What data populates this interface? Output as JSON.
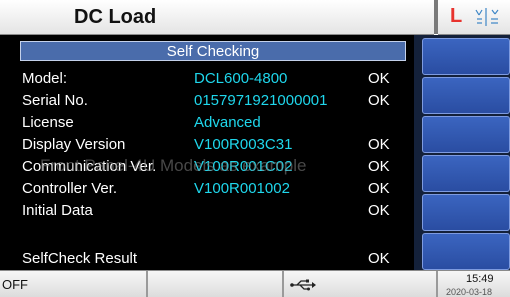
{
  "header": {
    "title": "DC Load",
    "brand_glyph": "L",
    "status_icon": "usb-status-icon"
  },
  "self_check": {
    "title": "Self Checking",
    "rows": [
      {
        "label": "Model:",
        "value": "DCL600-4800",
        "status": "OK"
      },
      {
        "label": "Serial No.",
        "value": "0157971921000001",
        "status": "OK"
      },
      {
        "label": "License",
        "value": "Advanced",
        "status": ""
      },
      {
        "label": "Display Version",
        "value": "V100R003C31",
        "status": "OK"
      },
      {
        "label": "Communication Ver.",
        "value": "V100R001C02",
        "status": "OK"
      },
      {
        "label": "Controller Ver.",
        "value": "V100R001002",
        "status": "OK"
      },
      {
        "label": "Initial Data",
        "value": "",
        "status": "OK"
      },
      {
        "label": "",
        "value": "",
        "status": ""
      },
      {
        "label": "SelfCheck Result",
        "value": "",
        "status": "OK"
      }
    ],
    "watermark": "Front Panel-4U Models as example"
  },
  "softkeys": [
    "",
    "",
    "",
    "",
    "",
    ""
  ],
  "footer": {
    "output_state": "OFF",
    "usb_icon": "usb-icon",
    "time": "15:49",
    "date": "2020-03-18"
  },
  "colors": {
    "value_text": "#1fd7ec",
    "title_bar": "#4a6cab",
    "softkey": "#2f57b0",
    "brand": "#e8332e"
  }
}
